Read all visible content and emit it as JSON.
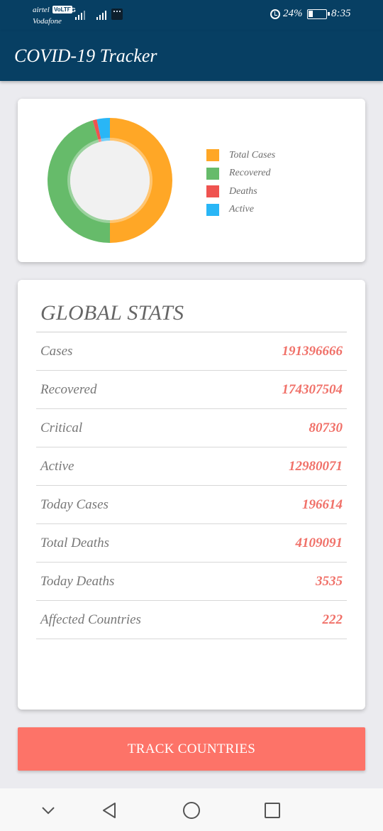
{
  "status_bar": {
    "carrier_1": "airtel",
    "volte_badge": "VoLTE",
    "net_type": "4G",
    "carrier_2": "Vodafone",
    "battery_percent": "24%",
    "time": "8:35",
    "battery_level": 0.24,
    "icons": [
      "signal-icon",
      "signal-icon",
      "message-icon",
      "alarm-icon",
      "battery-icon"
    ]
  },
  "app_bar": {
    "title": "COVID-19 Tracker"
  },
  "chart_data": {
    "type": "pie",
    "title": "",
    "legend_position": "right",
    "legend": [
      {
        "label": "Total Cases",
        "color": "#FFA726"
      },
      {
        "label": "Recovered",
        "color": "#66BB6A"
      },
      {
        "label": "Deaths",
        "color": "#EF5350"
      },
      {
        "label": "Active",
        "color": "#29B6F6"
      }
    ],
    "slices": [
      {
        "label": "Total Cases",
        "value": 191396666,
        "color": "#FFA726"
      },
      {
        "label": "Recovered",
        "value": 174307504,
        "color": "#66BB6A"
      },
      {
        "label": "Deaths",
        "value": 4109091,
        "color": "#EF5350"
      },
      {
        "label": "Active",
        "value": 12980071,
        "color": "#29B6F6"
      }
    ]
  },
  "global_stats": {
    "title": "GLOBAL STATS",
    "rows": [
      {
        "label": "Cases",
        "value": "191396666"
      },
      {
        "label": "Recovered",
        "value": "174307504"
      },
      {
        "label": "Critical",
        "value": "80730"
      },
      {
        "label": "Active",
        "value": "12980071"
      },
      {
        "label": "Today Cases",
        "value": "196614"
      },
      {
        "label": "Total Deaths",
        "value": "4109091"
      },
      {
        "label": "Today Deaths",
        "value": "3535"
      },
      {
        "label": "Affected Countries",
        "value": "222"
      }
    ]
  },
  "track_button": {
    "label": "TRACK COUNTRIES"
  },
  "nav_bar": {
    "buttons": [
      "chevron-down-icon",
      "back-icon",
      "home-icon",
      "recents-icon"
    ]
  },
  "colors": {
    "primary": "#073F63",
    "accent": "#FD7368",
    "stat_value": "#F07068"
  }
}
